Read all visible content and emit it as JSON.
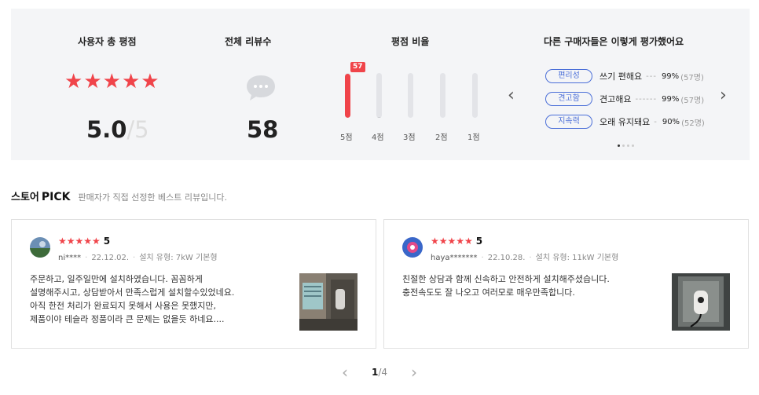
{
  "summary": {
    "rating_title": "사용자 총 평점",
    "stars": "★★★★★",
    "score": "5.0",
    "score_max": "/5",
    "reviews_title": "전체 리뷰수",
    "review_count": "58",
    "ratio_title": "평점 비율",
    "ratio": {
      "top_count": "57",
      "bars": [
        {
          "label": "5점",
          "value": 57
        },
        {
          "label": "4점",
          "value": 1
        },
        {
          "label": "3점",
          "value": 0
        },
        {
          "label": "2점",
          "value": 0
        },
        {
          "label": "1점",
          "value": 0
        }
      ],
      "total": 58
    },
    "eval_title": "다른 구매자들은 이렇게 평가했어요",
    "evals": [
      {
        "tag": "편리성",
        "text": "쓰기 편해요",
        "dots": "---",
        "pct": "99%",
        "cnt": "(57명)"
      },
      {
        "tag": "견고함",
        "text": "견고해요",
        "dots": "------",
        "pct": "99%",
        "cnt": "(57명)"
      },
      {
        "tag": "지속력",
        "text": "오래 유지돼요",
        "dots": "-",
        "pct": "90%",
        "cnt": "(52명)"
      }
    ],
    "prev_icon": "chevron-left-icon",
    "next_icon": "chevron-right-icon"
  },
  "pick": {
    "title_a": "스토어",
    "title_b": "PICK",
    "subtitle": "판매자가 직접 선정한 베스트 리뷰입니다."
  },
  "reviews": [
    {
      "stars": "★★★★★",
      "score": "5",
      "user": "ni****",
      "date": "22.12.02.",
      "type": "설치 유형: 7kW 기본형",
      "lines": [
        "주문하고, 일주일만에 설치하였습니다. 꼼꼼하게",
        "설명해주시고, 상담받아서 만족스럽게 설치할수있었네요.",
        "아직 한전 처리가 완료되지 못해서 사용은 못했지만,",
        "제품이야 테슬라 정품이라 큰 문제는 없을듯 하네요...."
      ]
    },
    {
      "stars": "★★★★★",
      "score": "5",
      "user": "haya*******",
      "date": "22.10.28.",
      "type": "설치 유형: 11kW 기본형",
      "lines": [
        "친절한 상담과 함께 신속하고 안전하게 설치해주셨습니다.",
        "충전속도도 잘 나오고 여러모로 매우만족합니다."
      ]
    }
  ],
  "pager": {
    "current": "1",
    "total": "/4"
  },
  "colors": {
    "accent": "#f0444a",
    "tag": "#4b6fd8",
    "panel": "#f4f5f7"
  }
}
